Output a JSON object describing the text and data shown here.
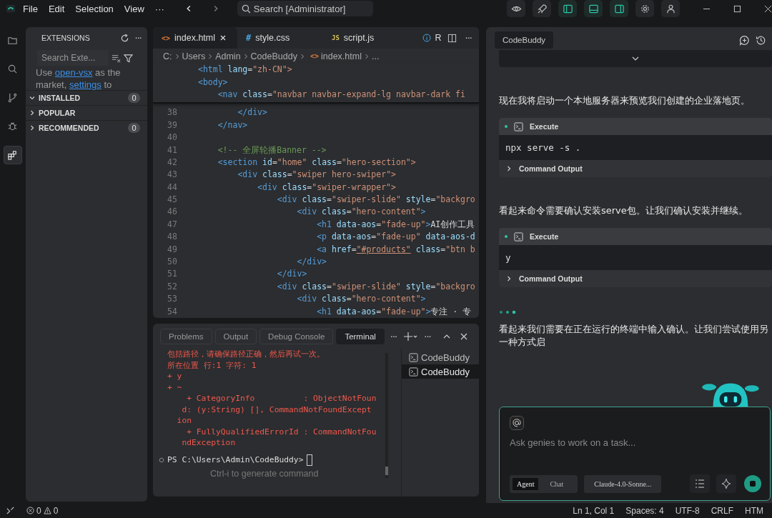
{
  "menu": [
    "File",
    "Edit",
    "Selection",
    "View",
    "···"
  ],
  "search": {
    "placeholder": "Search [Administrator]"
  },
  "toolbar": [
    {
      "kind": "eye",
      "on": false
    },
    {
      "kind": "rocket",
      "on": false
    },
    {
      "kind": "left",
      "on": true
    },
    {
      "kind": "bottom",
      "on": true
    },
    {
      "kind": "right",
      "on": true
    },
    {
      "kind": "gear",
      "on": false
    },
    {
      "kind": "person",
      "on": false
    }
  ],
  "activity": [
    {
      "kind": "files",
      "selected": false
    },
    {
      "kind": "search",
      "selected": false
    },
    {
      "kind": "branch",
      "selected": false
    },
    {
      "kind": "bug",
      "selected": false
    },
    {
      "kind": "extensions",
      "selected": true
    }
  ],
  "sidebar": {
    "title": "EXTENSIONS",
    "more": "···",
    "search_placeholder": "Search Exte...",
    "notice": {
      "before": "Use ",
      "link1": "open-vsx",
      "middle": " as the market, ",
      "link2": "settings",
      "after": " to"
    },
    "sections": [
      {
        "label": "INSTALLED",
        "count": "0",
        "expanded": true
      },
      {
        "label": "POPULAR",
        "expanded": false
      },
      {
        "label": "RECOMMENDED",
        "count": "0",
        "expanded": false
      }
    ]
  },
  "editor": {
    "tabs": [
      {
        "label": "index.html",
        "icon": "<>",
        "kind": "html",
        "selected": true
      },
      {
        "label": "style.css",
        "icon": "#",
        "kind": "css",
        "selected": false
      },
      {
        "label": "script.js",
        "icon": "JS",
        "kind": "js",
        "selected": false
      },
      {
        "label": "R",
        "kind": "info",
        "selected": false
      }
    ],
    "more": "···",
    "breadcrumb": [
      {
        "text": "C:"
      },
      {
        "text": "Users"
      },
      {
        "text": "Admin"
      },
      {
        "text": "CodeBuddy"
      },
      {
        "text": "index.html",
        "icon": "<>"
      },
      {
        "text": "..."
      }
    ],
    "sticky": [
      {
        "tokens": [
          {
            "color": "#569cd6",
            "t": "<html"
          },
          {
            "color": "#9cdcfe",
            "t": " lang"
          },
          {
            "color": "#d4d4d4",
            "t": "="
          },
          {
            "color": "#ce9178",
            "t": "\"zh-CN\">"
          }
        ]
      },
      {
        "tokens": [
          {
            "color": "#569cd6",
            "t": "<body>"
          }
        ]
      },
      {
        "tokens": [
          {
            "color": "#569cd6",
            "t": "    <nav"
          },
          {
            "color": "#9cdcfe",
            "t": " class"
          },
          {
            "color": "#d4d4d4",
            "t": "="
          },
          {
            "color": "#ce9178",
            "t": "\"navbar navbar-expand-lg navbar-dark fi"
          }
        ]
      }
    ],
    "lines": [
      {
        "n": "38",
        "tokens": [
          {
            "color": "#569cd6",
            "t": "        </div>"
          }
        ]
      },
      {
        "n": "39",
        "tokens": [
          {
            "color": "#569cd6",
            "t": "    </nav>"
          }
        ]
      },
      {
        "n": "40"
      },
      {
        "n": "41",
        "tokens": [
          {
            "color": "#6a9955",
            "t": "    <!-- 全屏轮播Banner -->"
          }
        ]
      },
      {
        "n": "42",
        "tokens": [
          {
            "color": "#569cd6",
            "t": "    <section"
          },
          {
            "color": "#9cdcfe",
            "t": " id"
          },
          {
            "color": "#d4d4d4",
            "t": "="
          },
          {
            "color": "#ce9178",
            "t": "\"home\""
          },
          {
            "color": "#9cdcfe",
            "t": " class"
          },
          {
            "color": "#d4d4d4",
            "t": "="
          },
          {
            "color": "#ce9178",
            "t": "\"hero-section\">"
          }
        ]
      },
      {
        "n": "43",
        "tokens": [
          {
            "color": "#569cd6",
            "t": "        <div"
          },
          {
            "color": "#9cdcfe",
            "t": " class"
          },
          {
            "color": "#d4d4d4",
            "t": "="
          },
          {
            "color": "#ce9178",
            "t": "\"swiper hero-swiper\">"
          }
        ]
      },
      {
        "n": "44",
        "tokens": [
          {
            "color": "#569cd6",
            "t": "            <div"
          },
          {
            "color": "#9cdcfe",
            "t": " class"
          },
          {
            "color": "#d4d4d4",
            "t": "="
          },
          {
            "color": "#ce9178",
            "t": "\"swiper-wrapper\">"
          }
        ]
      },
      {
        "n": "45",
        "tokens": [
          {
            "color": "#569cd6",
            "t": "                <div"
          },
          {
            "color": "#9cdcfe",
            "t": " class"
          },
          {
            "color": "#d4d4d4",
            "t": "="
          },
          {
            "color": "#ce9178",
            "t": "\"swiper-slide\""
          },
          {
            "color": "#9cdcfe",
            "t": " style"
          },
          {
            "color": "#d4d4d4",
            "t": "="
          },
          {
            "color": "#ce9178",
            "t": "\"backgro"
          }
        ]
      },
      {
        "n": "46",
        "tokens": [
          {
            "color": "#569cd6",
            "t": "                    <div"
          },
          {
            "color": "#9cdcfe",
            "t": " class"
          },
          {
            "color": "#d4d4d4",
            "t": "="
          },
          {
            "color": "#ce9178",
            "t": "\"hero-content\""
          },
          {
            "color": "#569cd6",
            "t": ">"
          }
        ]
      },
      {
        "n": "47",
        "tokens": [
          {
            "color": "#569cd6",
            "t": "                        <h1"
          },
          {
            "color": "#9cdcfe",
            "t": " data-aos"
          },
          {
            "color": "#d4d4d4",
            "t": "="
          },
          {
            "color": "#ce9178",
            "t": "\"fade-up\""
          },
          {
            "color": "#569cd6",
            "t": ">"
          },
          {
            "color": "#d4d4d4",
            "t": "AI创作工具"
          }
        ]
      },
      {
        "n": "48",
        "tokens": [
          {
            "color": "#569cd6",
            "t": "                        <p"
          },
          {
            "color": "#9cdcfe",
            "t": " data-aos"
          },
          {
            "color": "#d4d4d4",
            "t": "="
          },
          {
            "color": "#ce9178",
            "t": "\"fade-up\""
          },
          {
            "color": "#9cdcfe",
            "t": " data-aos-d"
          }
        ]
      },
      {
        "n": "49",
        "tokens": [
          {
            "color": "#569cd6",
            "t": "                        <a"
          },
          {
            "color": "#9cdcfe",
            "t": " href"
          },
          {
            "color": "#d4d4d4",
            "t": "="
          },
          {
            "color": "#ce9178",
            "t": "\"#products\"",
            "underline": true
          },
          {
            "color": "#9cdcfe",
            "t": " class"
          },
          {
            "color": "#d4d4d4",
            "t": "="
          },
          {
            "color": "#ce9178",
            "t": "\"btn b"
          }
        ]
      },
      {
        "n": "50",
        "tokens": [
          {
            "color": "#569cd6",
            "t": "                    </div>"
          }
        ]
      },
      {
        "n": "51",
        "tokens": [
          {
            "color": "#569cd6",
            "t": "                </div>"
          }
        ]
      },
      {
        "n": "52",
        "tokens": [
          {
            "color": "#569cd6",
            "t": "                <div"
          },
          {
            "color": "#9cdcfe",
            "t": " class"
          },
          {
            "color": "#d4d4d4",
            "t": "="
          },
          {
            "color": "#ce9178",
            "t": "\"swiper-slide\""
          },
          {
            "color": "#9cdcfe",
            "t": " style"
          },
          {
            "color": "#d4d4d4",
            "t": "="
          },
          {
            "color": "#ce9178",
            "t": "\"backgro"
          }
        ]
      },
      {
        "n": "53",
        "tokens": [
          {
            "color": "#569cd6",
            "t": "                    <div"
          },
          {
            "color": "#9cdcfe",
            "t": " class"
          },
          {
            "color": "#d4d4d4",
            "t": "="
          },
          {
            "color": "#ce9178",
            "t": "\"hero-content\""
          },
          {
            "color": "#569cd6",
            "t": ">"
          }
        ]
      },
      {
        "n": "54",
        "tokens": [
          {
            "color": "#569cd6",
            "t": "                        <h1"
          },
          {
            "color": "#9cdcfe",
            "t": " data-aos"
          },
          {
            "color": "#d4d4d4",
            "t": "="
          },
          {
            "color": "#ce9178",
            "t": "\"fade-up\""
          },
          {
            "color": "#569cd6",
            "t": ">"
          },
          {
            "color": "#d4d4d4",
            "t": "专注 · 专"
          }
        ]
      }
    ]
  },
  "panel": {
    "tabs": [
      {
        "label": "Problems",
        "selected": false
      },
      {
        "label": "Output",
        "selected": false
      },
      {
        "label": "Debug Console",
        "selected": false
      },
      {
        "label": "Terminal",
        "selected": true
      }
    ],
    "more": [
      "···",
      "···"
    ],
    "output": [
      "包括路径，请确保路径正确，然后再试一次。",
      "所在位置 行:1 字符: 1",
      "+ y",
      "+ ~",
      "    + CategoryInfo          : ObjectNotFoun",
      "   d: (y:String) [], CommandNotFoundExcept",
      "  ion",
      "    + FullyQualifiedErrorId : CommandNotFou",
      "   ndException"
    ],
    "prompt": "PS C:\\Users\\Admin\\CodeBuddy>",
    "hint": "Ctrl-i to generate command",
    "terminals": [
      {
        "label": "CodeBuddy",
        "selected": false
      },
      {
        "label": "CodeBuddy",
        "selected": true
      }
    ]
  },
  "chat": {
    "tab": "CodeBuddy",
    "messages": [
      {
        "kind": "collapsed"
      },
      {
        "kind": "text",
        "text": "现在我将启动一个本地服务器来预览我们创建的企业落地页。"
      },
      {
        "kind": "execute",
        "title": "Execute",
        "command": "npx serve -s .",
        "output_label": "Command Output"
      },
      {
        "kind": "text",
        "text": "看起来命令需要确认安装serve包。让我们确认安装并继续。"
      },
      {
        "kind": "execute",
        "title": "Execute",
        "command": "y",
        "output_label": "Command Output"
      },
      {
        "kind": "dots"
      },
      {
        "kind": "text",
        "text": "看起来我们需要在正在运行的终端中输入确认。让我们尝试使用另一种方式启"
      }
    ],
    "input": {
      "placeholder": "Ask genies to work on a task..."
    },
    "modes": [
      {
        "label": "Agent",
        "selected": true
      },
      {
        "label": "Chat",
        "selected": false
      }
    ],
    "model": "Claude-4.0-Sonne..."
  },
  "status": {
    "errors": "0",
    "warnings": "0",
    "items": [
      "Ln 1, Col 1",
      "Spaces: 4",
      "UTF-8",
      "CRLF",
      "HTM"
    ]
  }
}
